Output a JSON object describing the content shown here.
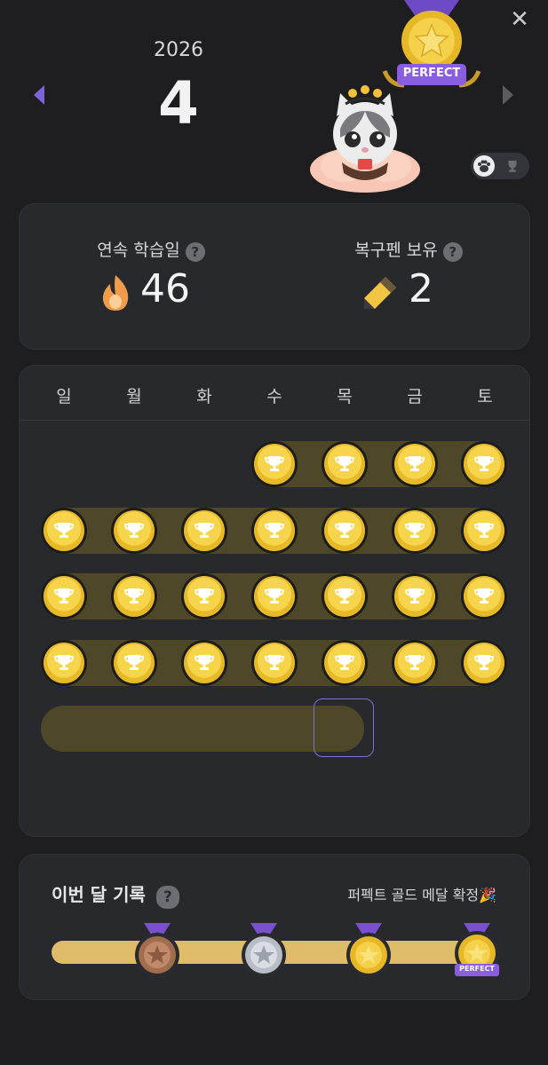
{
  "header": {
    "year": "2026",
    "month": "4",
    "close_glyph": "✕",
    "perfect_label": "PERFECT"
  },
  "stats": {
    "streak_label": "연속 학습일",
    "streak_value": "46",
    "pen_label": "복구펜 보유",
    "pen_value": "2",
    "help_glyph": "?"
  },
  "calendar": {
    "weekdays": [
      "일",
      "월",
      "화",
      "수",
      "목",
      "금",
      "토"
    ],
    "completed_days": 25,
    "today": "목"
  },
  "record": {
    "title": "이번 달 기록",
    "status": "퍼펙트 골드 메달 확정🎉",
    "tiers": [
      "bronze",
      "silver",
      "gold",
      "perfect"
    ],
    "perfect_label": "PERFECT"
  },
  "colors": {
    "background": "#1e1e21",
    "card": "#28292d",
    "accent": "#7a5fd6",
    "gold": "#f3cf44"
  }
}
